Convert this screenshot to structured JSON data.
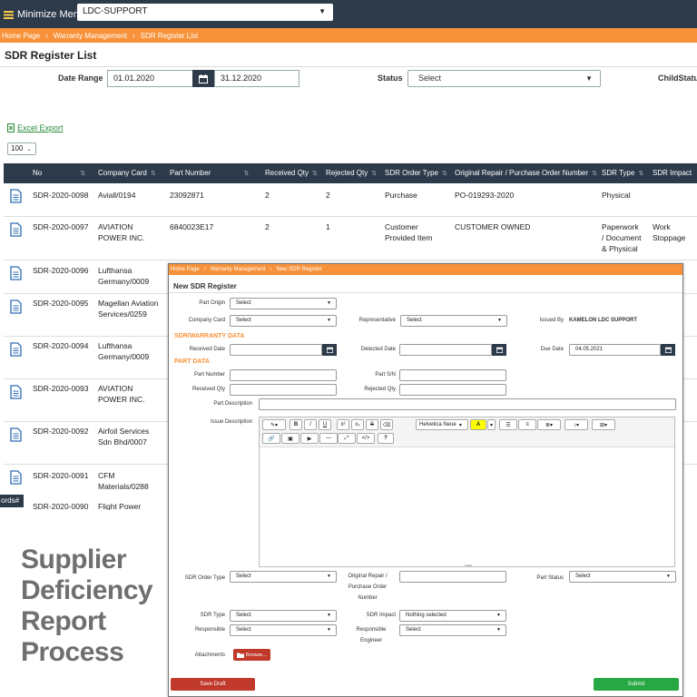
{
  "topbar": {
    "minimize_label": "Minimize Menu",
    "org_selected": "LDC-SUPPORT"
  },
  "breadcrumb": [
    "Home Page",
    "Warranty Management",
    "SDR Register List"
  ],
  "list": {
    "title": "SDR Register List",
    "date_range_label": "Date Range",
    "date_from": "01.01.2020",
    "date_to": "31.12.2020",
    "status_label": "Status",
    "status_value": "Select",
    "child_status_label": "ChildStatu",
    "excel_export": "Excel Export",
    "page_size": "100"
  },
  "table": {
    "columns": [
      "No",
      "Company Card",
      "Part Number",
      "Received Qty",
      "Rejected Qty",
      "SDR Order Type",
      "Original Repair / Purchase Order Number",
      "SDR Type",
      "SDR Impact"
    ],
    "rows": [
      {
        "no": "SDR-2020-0098",
        "company": "Aviall/0194",
        "part": "23092871",
        "received": "2",
        "rejected": "2",
        "order_type": "Purchase",
        "po": "PO-019293-2020",
        "sdr_type": "Physical",
        "impact": ""
      },
      {
        "no": "SDR-2020-0097",
        "company": "AVIATION\nPOWER INC.",
        "part": "6840023E17",
        "received": "2",
        "rejected": "1",
        "order_type": "Customer\nProvided Item",
        "po": "CUSTOMER OWNED",
        "sdr_type": "Paperwork\n/ Document\n& Physical",
        "impact": "Work\nStoppage"
      },
      {
        "no": "SDR-2020-0096",
        "company": "Lufthansa\nGermany/0009"
      },
      {
        "no": "SDR-2020-0095",
        "company": "Magellan Aviation\nServices/0259"
      },
      {
        "no": "SDR-2020-0094",
        "company": "Lufthansa\nGermany/0009"
      },
      {
        "no": "SDR-2020-0093",
        "company": "AVIATION\nPOWER INC."
      },
      {
        "no": "SDR-2020-0092",
        "company": "Airfoil Services\nSdn Bhd/0007"
      },
      {
        "no": "SDR-2020-0091",
        "company": "CFM\nMaterials/0288"
      },
      {
        "no": "SDR-2020-0090",
        "company": "Flight Power"
      }
    ],
    "records_label": "ords#"
  },
  "slogan": "Supplier\nDeficiency\nReport\nProcess",
  "modal": {
    "breadcrumb": [
      "Home Page",
      "Warranty Management",
      "New SDR Register"
    ],
    "title": "New SDR Register",
    "part_origin_label": "Part Origin",
    "part_origin_value": "Select",
    "company_card_label": "Company Card",
    "company_card_value": "Select",
    "representative_label": "Representative",
    "representative_value": "Select",
    "issued_by_label": "Issued By",
    "issued_by_value": "KAMELON LDC SUPPORT",
    "section_warranty": "SDR/WARRANTY DATA",
    "received_date_label": "Received Date",
    "detected_date_label": "Detected Date",
    "due_date_label": "Due Date",
    "due_date_value": "04.05.2021",
    "section_part": "PART DATA",
    "part_number_label": "Part Number",
    "part_sn_label": "Part S/N",
    "received_qty_label": "Received Qty",
    "rejected_qty_label": "Rejected Qty",
    "part_description_label": "Part Description",
    "issue_description_label": "Issue Description",
    "editor_font": "Helvetica Neue",
    "sdr_order_type_label": "SDR Order Type",
    "sdr_order_type_value": "Select",
    "original_repair_label": "Original Repair /\nPurchase Order\nNumber",
    "part_status_label": "Part Status",
    "part_status_value": "Select",
    "sdr_type_label": "SDR Type",
    "sdr_type_value": "Select",
    "sdr_impact_label": "SDR Impact",
    "sdr_impact_value": "Nothing selected",
    "responsible_label": "Responsible",
    "responsible_value": "Select",
    "responsible_engineer_label": "Responsible\nEngineer",
    "responsible_engineer_value": "Select",
    "attachments_label": "Attachments",
    "browse_label": "Browse...",
    "save_draft_label": "Save Draft",
    "submit_label": "Submit"
  },
  "colors": {
    "navy": "#2d3a4a",
    "orange": "#f7923a",
    "red": "#c0392b",
    "green": "#27a844"
  }
}
